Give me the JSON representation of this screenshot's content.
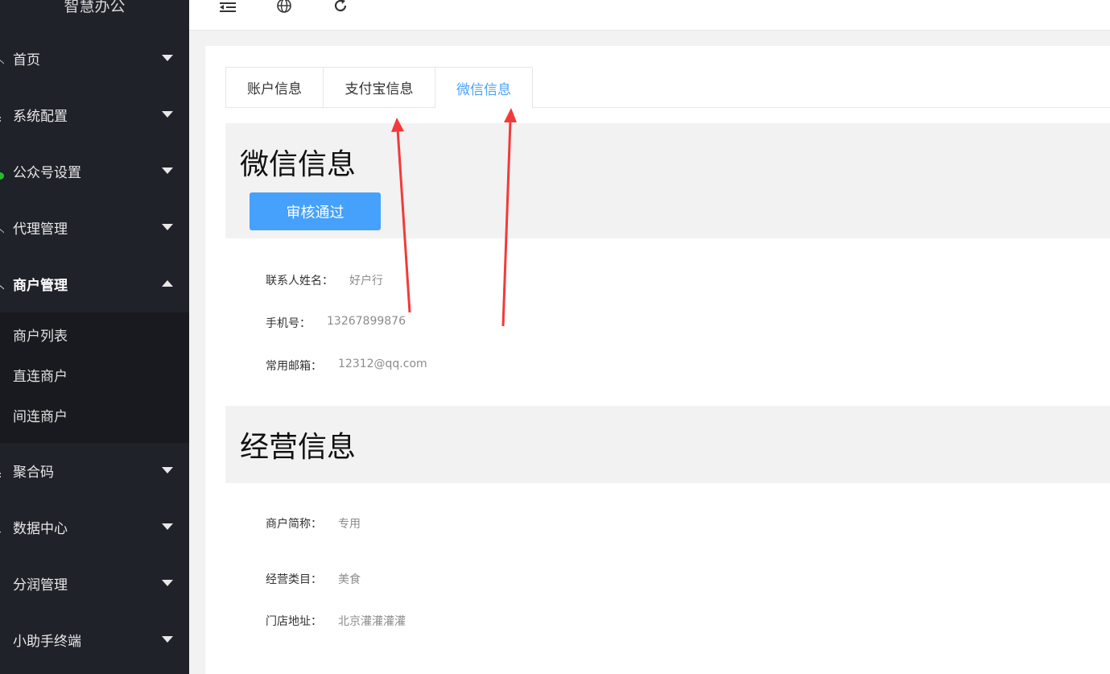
{
  "sidebar": {
    "brand": "智慧办公",
    "items": [
      {
        "label": "首页"
      },
      {
        "label": "系统配置"
      },
      {
        "label": "公众号设置"
      },
      {
        "label": "代理管理"
      },
      {
        "label": "商户管理"
      },
      {
        "label": "聚合码"
      },
      {
        "label": "数据中心"
      },
      {
        "label": "分润管理"
      },
      {
        "label": "小助手终端"
      }
    ],
    "submenu": [
      {
        "label": "商户列表"
      },
      {
        "label": "直连商户"
      },
      {
        "label": "间连商户"
      }
    ]
  },
  "tabs": [
    {
      "label": "账户信息"
    },
    {
      "label": "支付宝信息"
    },
    {
      "label": "微信信息"
    }
  ],
  "wechat_section": {
    "title": "微信信息",
    "approve_label": "审核通过",
    "fields": [
      {
        "key": "联系人姓名：",
        "value": "好户行"
      },
      {
        "key": "手机号：",
        "value": "13267899876"
      },
      {
        "key": "常用邮箱：",
        "value": "12312@qq.com"
      }
    ]
  },
  "business_section": {
    "title": "经营信息",
    "fields": [
      {
        "key": "商户简称：",
        "value": "专用"
      },
      {
        "key": "经营类目：",
        "value": "美食"
      },
      {
        "key": "门店地址：",
        "value": "北京灌灌灌灌"
      }
    ]
  },
  "colors": {
    "sidebar_bg": "#20222a",
    "accent": "#45a1fb",
    "arrow": "#f23a3a",
    "bullet_green": "#22bb33"
  }
}
